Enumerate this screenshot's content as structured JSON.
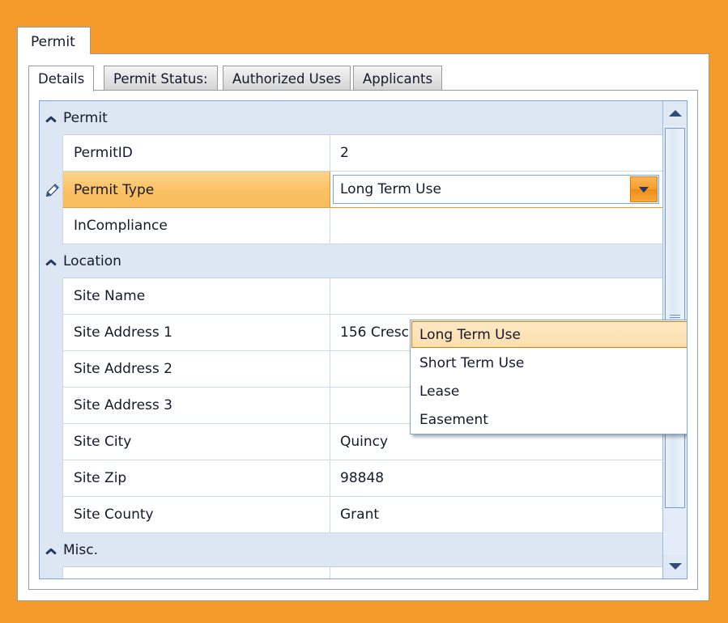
{
  "window": {
    "background_color": "#f59b2c",
    "outer_tab_label": "Permit"
  },
  "inner_tabs": [
    {
      "label": "Details",
      "selected": true
    },
    {
      "label": "Permit Status:",
      "selected": false
    },
    {
      "label": "Authorized Uses",
      "selected": false
    },
    {
      "label": "Applicants",
      "selected": false
    }
  ],
  "property_grid": {
    "rows": [
      {
        "kind": "group",
        "name": "Permit",
        "expanded": true
      },
      {
        "kind": "field",
        "name": "PermitID",
        "value": "2",
        "selected": false,
        "editing": false
      },
      {
        "kind": "field",
        "name": "Permit Type",
        "value": "Long Term Use",
        "selected": true,
        "editing": true
      },
      {
        "kind": "field",
        "name": "InCompliance",
        "value": "",
        "selected": false,
        "editing": false
      },
      {
        "kind": "group",
        "name": "Location",
        "expanded": true
      },
      {
        "kind": "field",
        "name": "Site Name",
        "value": "",
        "selected": false,
        "editing": false
      },
      {
        "kind": "field",
        "name": "Site Address 1",
        "value": "156 Crescent Bar Road",
        "selected": false,
        "editing": false
      },
      {
        "kind": "field",
        "name": "Site Address 2",
        "value": "",
        "selected": false,
        "editing": false
      },
      {
        "kind": "field",
        "name": "Site Address 3",
        "value": "",
        "selected": false,
        "editing": false
      },
      {
        "kind": "field",
        "name": "Site City",
        "value": "Quincy",
        "selected": false,
        "editing": false
      },
      {
        "kind": "field",
        "name": "Site Zip",
        "value": "98848",
        "selected": false,
        "editing": false
      },
      {
        "kind": "field",
        "name": "Site County",
        "value": "Grant",
        "selected": false,
        "editing": false
      },
      {
        "kind": "group",
        "name": "Misc.",
        "expanded": true
      },
      {
        "kind": "field",
        "name": "",
        "value": "",
        "selected": false,
        "editing": false
      }
    ]
  },
  "combo_editor": {
    "value": "Long Term Use",
    "expanded": true,
    "options": [
      {
        "label": "Long Term Use",
        "highlighted": true
      },
      {
        "label": "Short Term Use",
        "highlighted": false
      },
      {
        "label": "Lease",
        "highlighted": false
      },
      {
        "label": "Easement",
        "highlighted": false
      }
    ]
  },
  "scrollbar": {
    "orientation": "vertical",
    "up_icon": "triangle-up-icon",
    "down_icon": "triangle-down-icon"
  },
  "colors": {
    "window_orange": "#f59b2c",
    "selected_row_orange": "#fbc166",
    "group_header_blue": "#dde7f4",
    "grid_border_blue": "#7ea6d4",
    "dropdown_highlight": "#fce0ad"
  }
}
